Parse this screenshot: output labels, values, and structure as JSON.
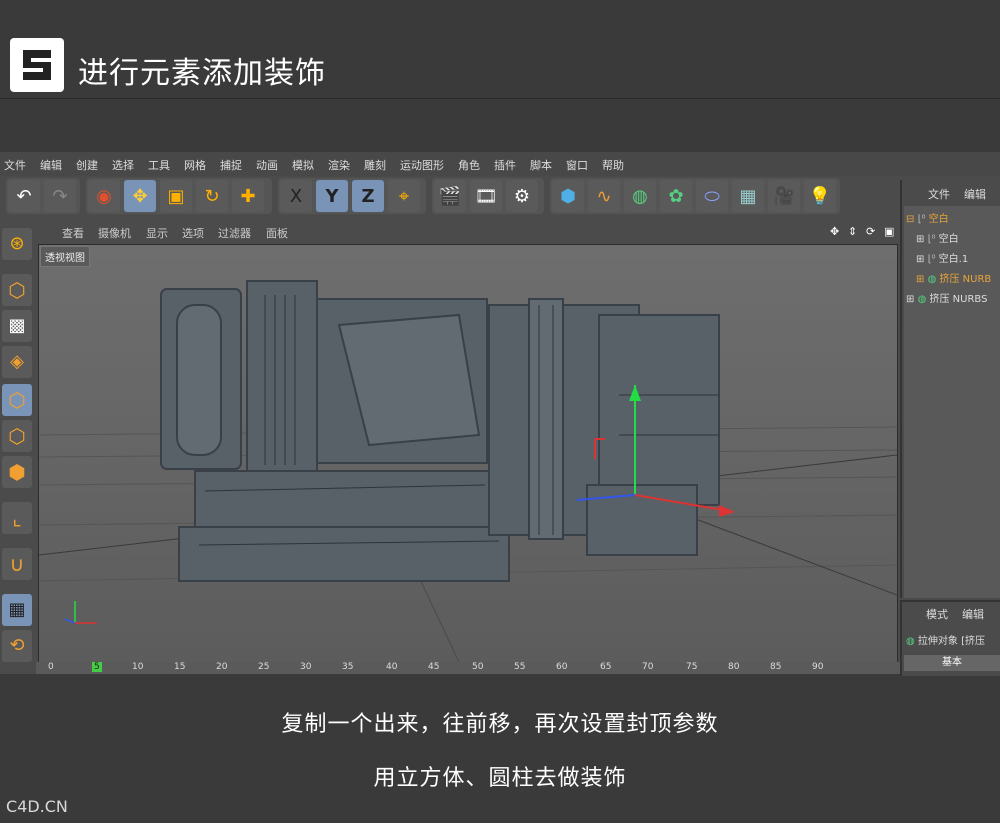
{
  "header": {
    "title": "进行元素添加装饰",
    "logo_glyph": "S"
  },
  "menu": [
    "文件",
    "编辑",
    "创建",
    "选择",
    "工具",
    "网格",
    "捕捉",
    "动画",
    "模拟",
    "渲染",
    "雕刻",
    "运动图形",
    "角色",
    "插件",
    "脚本",
    "窗口",
    "帮助"
  ],
  "toolbar": {
    "coord_buttons": [
      "X",
      "Y",
      "Z"
    ]
  },
  "viewport": {
    "menu": [
      "查看",
      "摄像机",
      "显示",
      "选项",
      "过滤器",
      "面板"
    ],
    "label": "透视视图"
  },
  "timeline": {
    "ticks": [
      "0",
      "5",
      "10",
      "15",
      "20",
      "25",
      "30",
      "35",
      "40",
      "45",
      "50",
      "55",
      "60",
      "65",
      "70",
      "75",
      "80",
      "85",
      "90"
    ]
  },
  "object_manager": {
    "menu": [
      "文件",
      "编辑"
    ],
    "nodes": [
      {
        "label": "空白",
        "active": true
      },
      {
        "label": "空白",
        "active": false
      },
      {
        "label": "空白.1",
        "active": false
      },
      {
        "label": "挤压 NURB",
        "active": true
      },
      {
        "label": "挤压 NURBS",
        "active": false
      }
    ]
  },
  "attribute_manager": {
    "menu": [
      "模式",
      "编辑"
    ],
    "object": "拉伸对象 [挤压",
    "tab": "基本"
  },
  "captions": {
    "line1": "复制一个出来，往前移，再次设置封顶参数",
    "line2": "用立方体、圆柱去做装饰"
  },
  "watermark": "C4D.CN",
  "colors": {
    "accent": "#7a94b8",
    "active_node": "#e8a33a",
    "background": "#3a3a3a"
  }
}
